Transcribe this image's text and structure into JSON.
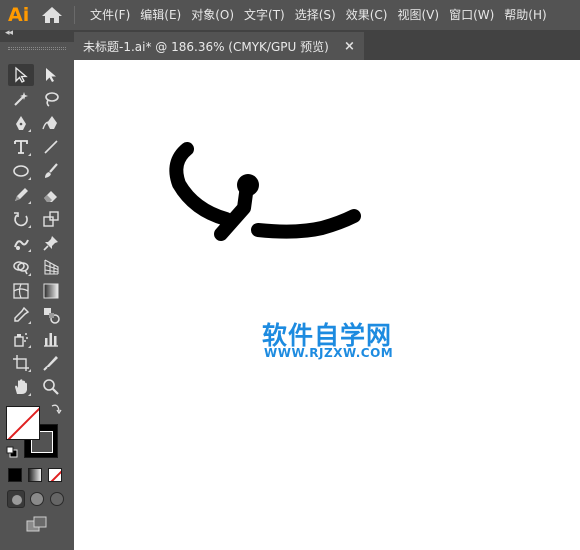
{
  "app": {
    "logo": "Ai",
    "accent": "#ff9a00"
  },
  "menu": {
    "items": [
      "文件(F)",
      "编辑(E)",
      "对象(O)",
      "文字(T)",
      "选择(S)",
      "效果(C)",
      "视图(V)",
      "窗口(W)",
      "帮助(H)"
    ]
  },
  "document": {
    "tab_title": "未标题-1.ai* @ 186.36% (CMYK/GPU 预览)",
    "close_glyph": "×"
  },
  "toolpanel": {
    "collapse_glyph": "◂◂",
    "tools": [
      "selection-tool",
      "direct-selection-tool",
      "magic-wand-tool",
      "lasso-tool",
      "pen-tool",
      "curvature-tool",
      "type-tool",
      "line-segment-tool",
      "ellipse-tool",
      "paintbrush-tool",
      "pencil-tool",
      "eraser-tool",
      "rotate-tool",
      "scale-tool",
      "warp-tool",
      "free-transform-tool",
      "shape-builder-tool",
      "perspective-grid-tool",
      "mesh-tool",
      "gradient-tool",
      "eyedropper-tool",
      "blend-tool",
      "symbol-sprayer-tool",
      "column-graph-tool",
      "artboard-tool",
      "slice-tool",
      "hand-tool",
      "zoom-tool"
    ],
    "fill": "none",
    "stroke": "#000000"
  },
  "canvas": {
    "background": "#ffffff",
    "watermark_cn": "软件自学网",
    "watermark_url": "WWW.RJZXW.COM",
    "watermark_color": "#1d8be0"
  }
}
